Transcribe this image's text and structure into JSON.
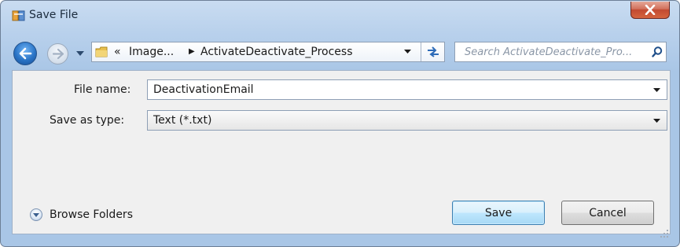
{
  "window": {
    "title": "Save File",
    "close_icon": "close-x-icon"
  },
  "navigation": {
    "back_icon": "back-arrow-icon",
    "forward_icon": "forward-arrow-icon",
    "history_icon": "chevron-down-icon",
    "refresh_icon": "refresh-icon"
  },
  "address_bar": {
    "folder_icon": "folder-icon",
    "overflow_glyph": "«",
    "segments": [
      "Image...",
      "ActivateDeactivate_Process"
    ],
    "separator_glyph": "▶"
  },
  "search": {
    "placeholder": "Search ActivateDeactivate_Pro...",
    "icon": "search-icon"
  },
  "form": {
    "file_name_label": "File name:",
    "file_name_value": "DeactivationEmail",
    "save_type_label": "Save as type:",
    "save_type_value": "Text (*.txt)"
  },
  "footer": {
    "browse_folders_label": "Browse Folders",
    "save_label": "Save",
    "cancel_label": "Cancel"
  },
  "colors": {
    "window_frame": "#b9d1ec",
    "close_button": "#c24a31",
    "save_button_border": "#3c7fb1"
  }
}
